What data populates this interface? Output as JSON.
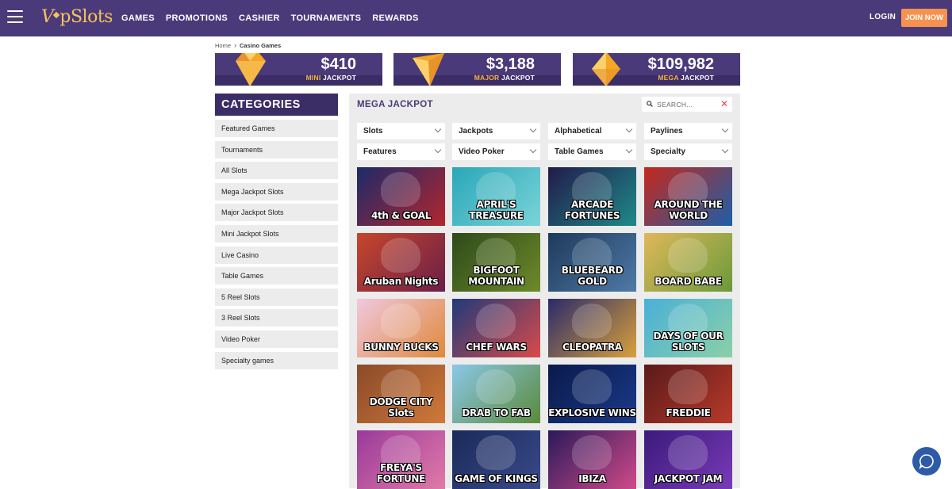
{
  "header": {
    "logo_text": "VipSlots",
    "nav": [
      "GAMES",
      "PROMOTIONS",
      "CASHIER",
      "TOURNAMENTS",
      "REWARDS"
    ],
    "login": "LOGIN",
    "join": "JOIN NOW"
  },
  "breadcrumb": {
    "home": "Home",
    "current": "Casino Games"
  },
  "jackpots": [
    {
      "amount": "$410",
      "tier": "MINI",
      "suffix": "JACKPOT"
    },
    {
      "amount": "$3,188",
      "tier": "MAJOR",
      "suffix": "JACKPOT"
    },
    {
      "amount": "$109,982",
      "tier": "MEGA",
      "suffix": "JACKPOT"
    }
  ],
  "sidebar": {
    "title": "CATEGORIES",
    "items": [
      "Featured Games",
      "Tournaments",
      "All Slots",
      "Mega Jackpot Slots",
      "Major Jackpot Slots",
      "Mini Jackpot Slots",
      "Live Casino",
      "Table Games",
      "5 Reel Slots",
      "3 Reel Slots",
      "Video Poker",
      "Specialty games"
    ]
  },
  "main": {
    "title": "MEGA JACKPOT",
    "search_placeholder": "SEARCH...",
    "filters": [
      "Slots",
      "Jackpots",
      "Alphabetical",
      "Paylines",
      "Features",
      "Video Poker",
      "Table Games",
      "Specialty"
    ],
    "games": [
      {
        "name": "4th & GOAL",
        "bg1": "#1c2a6b",
        "bg2": "#b3262e"
      },
      {
        "name": "APRIL'S TREASURE",
        "bg1": "#2aa7b8",
        "bg2": "#7ad4d8"
      },
      {
        "name": "ARCADE FORTUNES",
        "bg1": "#221a4a",
        "bg2": "#1e8a8a"
      },
      {
        "name": "AROUND THE WORLD",
        "bg1": "#c5281c",
        "bg2": "#1b5fa8"
      },
      {
        "name": "Aruban Nights",
        "bg1": "#c7462a",
        "bg2": "#6a1f4a"
      },
      {
        "name": "BIGFOOT MOUNTAIN",
        "bg1": "#2d4a1a",
        "bg2": "#6e8a2a"
      },
      {
        "name": "BLUEBEARD GOLD",
        "bg1": "#1e3a5a",
        "bg2": "#4f7aa8"
      },
      {
        "name": "BOARD BABE",
        "bg1": "#e0b85a",
        "bg2": "#6a9a3a"
      },
      {
        "name": "BUNNY BUCKS",
        "bg1": "#f0c8e0",
        "bg2": "#e0893a"
      },
      {
        "name": "CHEF WARS",
        "bg1": "#1f3a7a",
        "bg2": "#d94a4a"
      },
      {
        "name": "CLEOPATRA",
        "bg1": "#2a2a6a",
        "bg2": "#d9a03a"
      },
      {
        "name": "DAYS OF OUR SLOTS",
        "bg1": "#4ab0d8",
        "bg2": "#8ad0a8"
      },
      {
        "name": "DODGE CITY Slots",
        "bg1": "#8a4a2a",
        "bg2": "#d07a3a"
      },
      {
        "name": "DRAB TO FAB",
        "bg1": "#8ac8e8",
        "bg2": "#5a8a3a"
      },
      {
        "name": "EXPLOSIVE WINS",
        "bg1": "#0a1a4a",
        "bg2": "#1a3a8a"
      },
      {
        "name": "FREDDIE",
        "bg1": "#5a1a1a",
        "bg2": "#b83a2a"
      },
      {
        "name": "FREYA'S FORTUNE",
        "bg1": "#9a3a9a",
        "bg2": "#e07aa8"
      },
      {
        "name": "GAME OF KINGS",
        "bg1": "#1a2a5a",
        "bg2": "#3a4a8a"
      },
      {
        "name": "IBIZA",
        "bg1": "#2a1a5a",
        "bg2": "#d04a8a"
      },
      {
        "name": "JACKPOT JAM",
        "bg1": "#3a1a7a",
        "bg2": "#7a3ab8"
      }
    ]
  },
  "colors": {
    "brand": "#4a3a7a",
    "accent": "#f5924e",
    "gold": "#f5b342"
  }
}
